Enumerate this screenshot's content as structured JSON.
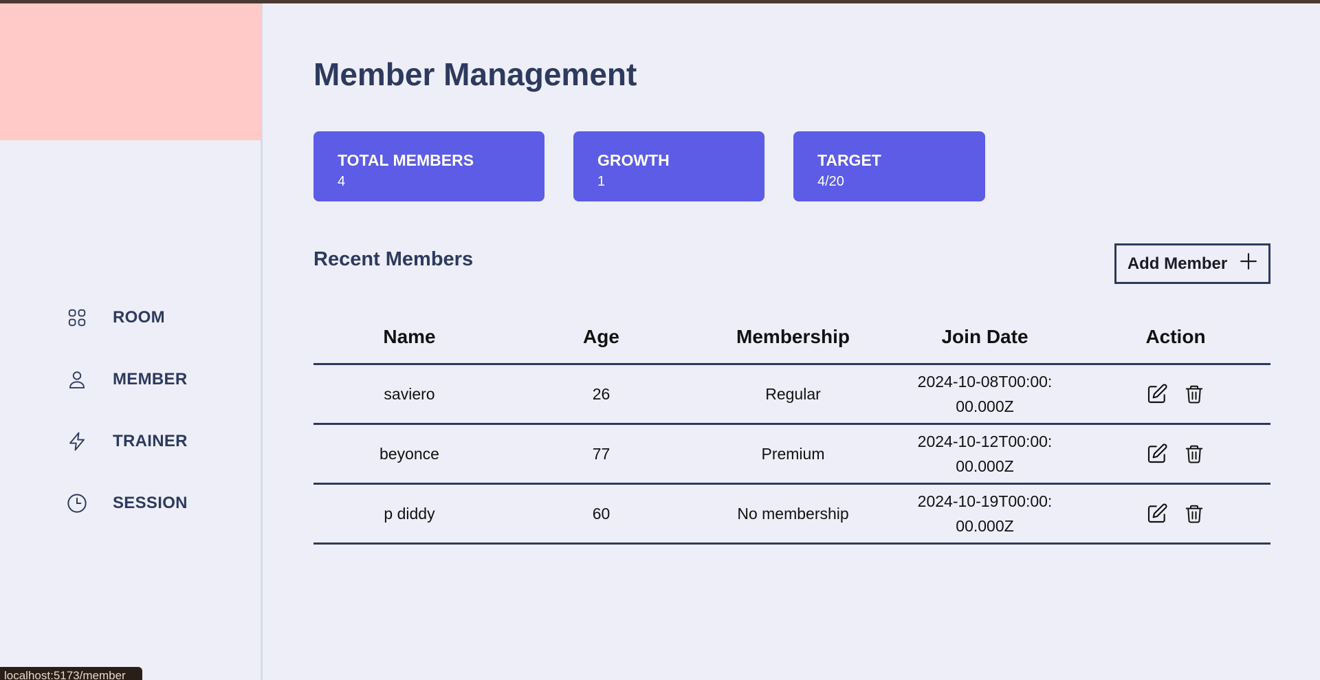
{
  "sidebar": {
    "items": [
      {
        "label": "ROOM",
        "icon": "grid-icon"
      },
      {
        "label": "MEMBER",
        "icon": "user-icon"
      },
      {
        "label": "TRAINER",
        "icon": "lightning-icon"
      },
      {
        "label": "SESSION",
        "icon": "clock-icon"
      }
    ]
  },
  "page": {
    "title": "Member Management"
  },
  "stats": [
    {
      "label": "TOTAL MEMBERS",
      "value": "4"
    },
    {
      "label": "GROWTH",
      "value": "1"
    },
    {
      "label": "TARGET",
      "value": "4/20"
    }
  ],
  "section": {
    "title": "Recent Members",
    "add_label": "Add Member"
  },
  "table": {
    "headers": [
      "Name",
      "Age",
      "Membership",
      "Join Date",
      "Action"
    ],
    "rows": [
      {
        "name": "saviero",
        "age": "26",
        "membership": "Regular",
        "join_date": "2024-10-08T00:00:00.000Z"
      },
      {
        "name": "beyonce",
        "age": "77",
        "membership": "Premium",
        "join_date": "2024-10-12T00:00:00.000Z"
      },
      {
        "name": "p diddy",
        "age": "60",
        "membership": "No membership",
        "join_date": "2024-10-19T00:00:00.000Z"
      }
    ]
  },
  "status_bar": {
    "url": "localhost:5173/member"
  },
  "colors": {
    "accent": "#5c5ce6",
    "text_dark": "#2d3a5e",
    "logo_bg": "#ffcac7",
    "page_bg": "#eeeef8"
  }
}
